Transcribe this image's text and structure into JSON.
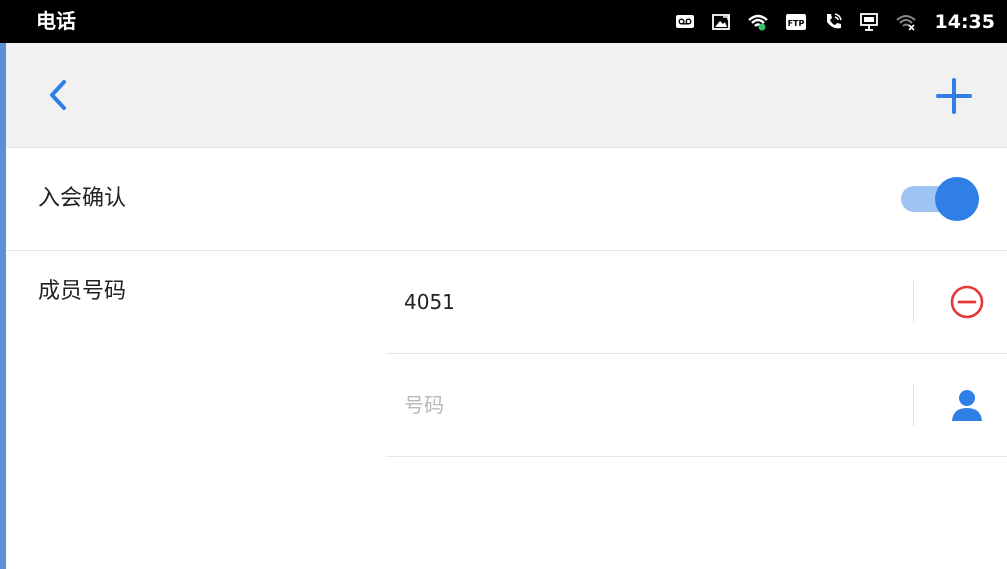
{
  "status_bar": {
    "title": "电话",
    "time": "14:35",
    "icons": [
      "voicemail-icon",
      "screenshot-icon",
      "wifi-icon",
      "ftp-icon",
      "call-icon",
      "monitor-icon",
      "wifi-off-icon"
    ],
    "ftp_label": "FTP"
  },
  "app_bar": {
    "back_icon": "chevron-left-icon",
    "add_icon": "plus-icon",
    "accent_color": "#2f7fe6"
  },
  "confirm_row": {
    "label": "入会确认",
    "toggle_on": true
  },
  "members": {
    "label": "成员号码",
    "entries": [
      {
        "value": "4051",
        "action_icon": "remove-circle-icon"
      }
    ],
    "new_entry": {
      "placeholder": "号码",
      "action_icon": "contact-person-icon"
    }
  }
}
